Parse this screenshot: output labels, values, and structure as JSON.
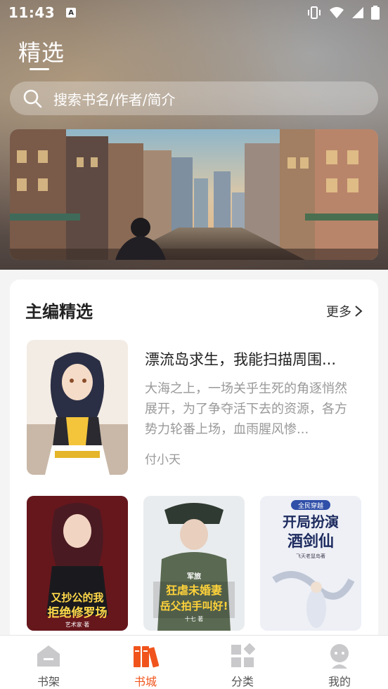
{
  "status_bar": {
    "time": "11:43",
    "notification_icon": "A"
  },
  "header": {
    "title": "精选"
  },
  "search": {
    "placeholder": "搜索书名/作者/简介"
  },
  "section": {
    "title": "主编精选",
    "more_label": "更多"
  },
  "featured_book": {
    "title": "漂流岛求生，我能扫描周围...",
    "description": "大海之上，一场关乎生死的角逐悄然展开，为了争夺活下去的资源，各方势力轮番上场，血雨腥风惨...",
    "author": "付小天"
  },
  "books": [
    {
      "cover_text": "又抄公的我拒绝修罗场",
      "cover_sub": "艺术家·著"
    },
    {
      "cover_text": "军旅 狂虐未婚妻 岳父拍手叫好!",
      "cover_sub": "十七 著"
    },
    {
      "cover_text": "全民穿越 开局扮演酒剑仙",
      "cover_sub": "飞天老鼠岛著"
    }
  ],
  "tabs": [
    {
      "label": "书架",
      "icon": "bookshelf-icon"
    },
    {
      "label": "书城",
      "icon": "bookstore-icon",
      "active": true
    },
    {
      "label": "分类",
      "icon": "category-icon"
    },
    {
      "label": "我的",
      "icon": "profile-icon"
    }
  ],
  "colors": {
    "accent": "#f0541c",
    "panel_bg": "#ffffff"
  }
}
